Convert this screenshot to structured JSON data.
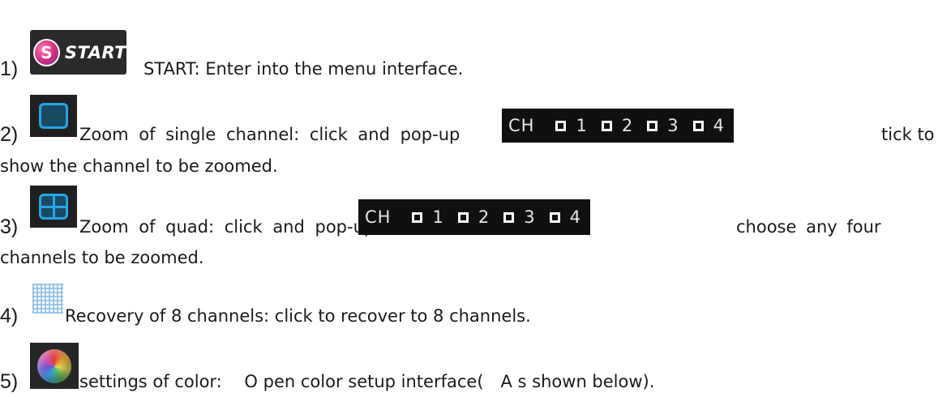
{
  "items": [
    {
      "num": "1)",
      "start_letter": "S",
      "start_word": "START",
      "text": "START: Enter into the menu interface."
    },
    {
      "num": "2)",
      "text_a": "Zoom of single channel: click and pop-up",
      "text_b": "tick to",
      "text_cont": "show the channel to be zoomed."
    },
    {
      "num": "3)",
      "text_a": "Zoom of quad: click and pop-up",
      "text_b": "choose any four",
      "text_cont": "channels to be zoomed."
    },
    {
      "num": "4)",
      "text": "Recovery of 8 channels: click to recover to 8 channels."
    },
    {
      "num": "5)",
      "text": "settings of color: 　O pen color setup interface(　A s shown below)."
    }
  ],
  "popup": {
    "label": "CH",
    "channels": [
      "1",
      "2",
      "3",
      "4"
    ]
  }
}
